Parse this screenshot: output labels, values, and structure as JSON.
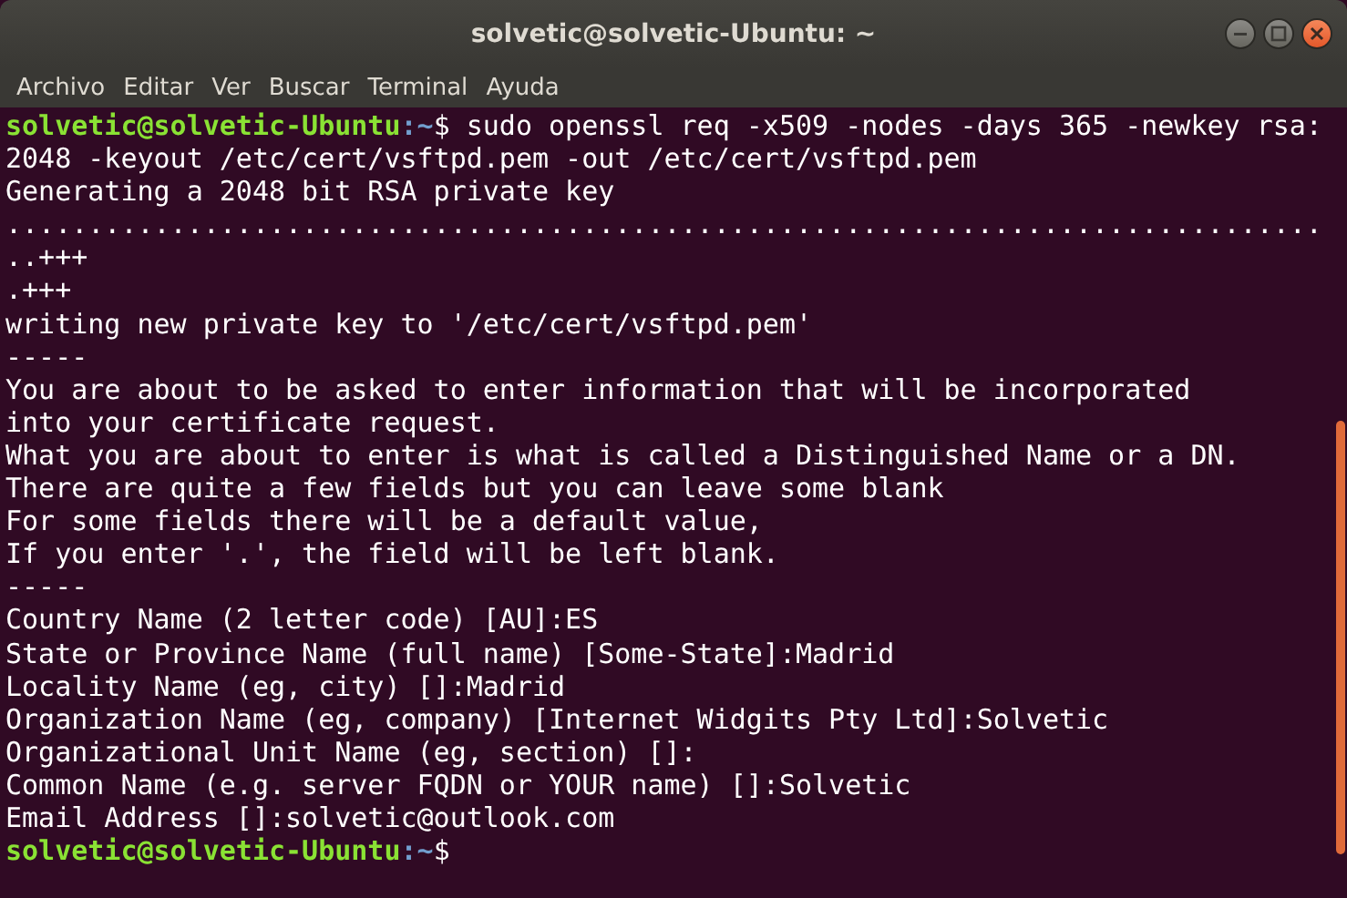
{
  "window": {
    "title": "solvetic@solvetic-Ubuntu: ~"
  },
  "menu": [
    "Archivo",
    "Editar",
    "Ver",
    "Buscar",
    "Terminal",
    "Ayuda"
  ],
  "terminal": {
    "lines": [
      {
        "kind": "prompt",
        "user": "solvetic@solvetic-Ubuntu",
        "path": ":~",
        "symbol": "$",
        "command_lines": [
          "sudo openssl req -x509 -nodes -days 365 -newkey rsa:",
          "2048 -keyout /etc/cert/vsftpd.pem -out /etc/cert/vsftpd.pem"
        ]
      },
      {
        "kind": "output",
        "text": "Generating a 2048 bit RSA private key"
      },
      {
        "kind": "output",
        "text": "................................................................................"
      },
      {
        "kind": "output",
        "text": "..+++"
      },
      {
        "kind": "output",
        "text": ".+++"
      },
      {
        "kind": "output",
        "text": "writing new private key to '/etc/cert/vsftpd.pem'"
      },
      {
        "kind": "output",
        "text": "-----"
      },
      {
        "kind": "output",
        "text": "You are about to be asked to enter information that will be incorporated"
      },
      {
        "kind": "output",
        "text": "into your certificate request."
      },
      {
        "kind": "output",
        "text": "What you are about to enter is what is called a Distinguished Name or a DN."
      },
      {
        "kind": "output",
        "text": "There are quite a few fields but you can leave some blank"
      },
      {
        "kind": "output",
        "text": "For some fields there will be a default value,"
      },
      {
        "kind": "output",
        "text": "If you enter '.', the field will be left blank."
      },
      {
        "kind": "output",
        "text": "-----"
      },
      {
        "kind": "output",
        "text": "Country Name (2 letter code) [AU]:ES"
      },
      {
        "kind": "output",
        "text": "State or Province Name (full name) [Some-State]:Madrid"
      },
      {
        "kind": "output",
        "text": "Locality Name (eg, city) []:Madrid"
      },
      {
        "kind": "output",
        "text": "Organization Name (eg, company) [Internet Widgits Pty Ltd]:Solvetic"
      },
      {
        "kind": "output",
        "text": "Organizational Unit Name (eg, section) []:"
      },
      {
        "kind": "output",
        "text": "Common Name (e.g. server FQDN or YOUR name) []:Solvetic"
      },
      {
        "kind": "output",
        "text": "Email Address []:solvetic@outlook.com"
      },
      {
        "kind": "prompt",
        "user": "solvetic@solvetic-Ubuntu",
        "path": ":~",
        "symbol": "$"
      }
    ]
  }
}
